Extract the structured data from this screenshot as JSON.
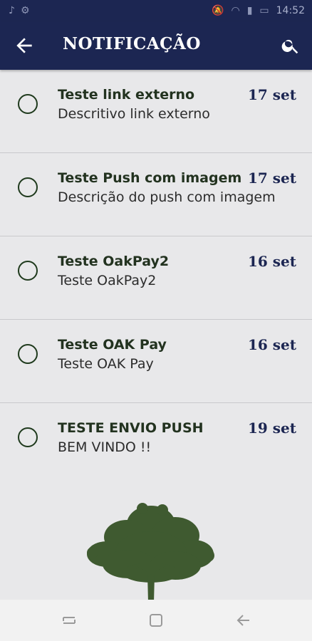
{
  "status": {
    "time": "14:52"
  },
  "appbar": {
    "title": "NOTIFICAÇÃO",
    "back_icon": "arrow-left-icon",
    "search_icon": "search-icon",
    "color": "#1c2652"
  },
  "notifications": [
    {
      "title": "Teste link externo",
      "description": "Descritivo link externo",
      "date": "17 set"
    },
    {
      "title": "Teste Push com imagem",
      "description": "Descrição do push com imagem",
      "date": "17 set"
    },
    {
      "title": "Teste OakPay2",
      "description": "Teste OakPay2",
      "date": "16 set"
    },
    {
      "title": "Teste OAK Pay",
      "description": "Teste OAK Pay",
      "date": "16 set"
    },
    {
      "title": "TESTE ENVIO PUSH",
      "description": "BEM VINDO !!",
      "date": "19 set"
    }
  ],
  "navbar": {
    "icons": [
      "recent-apps-icon",
      "home-icon",
      "back-icon"
    ]
  },
  "colors": {
    "accent": "#1c2652",
    "tree": "#3f5a30"
  }
}
